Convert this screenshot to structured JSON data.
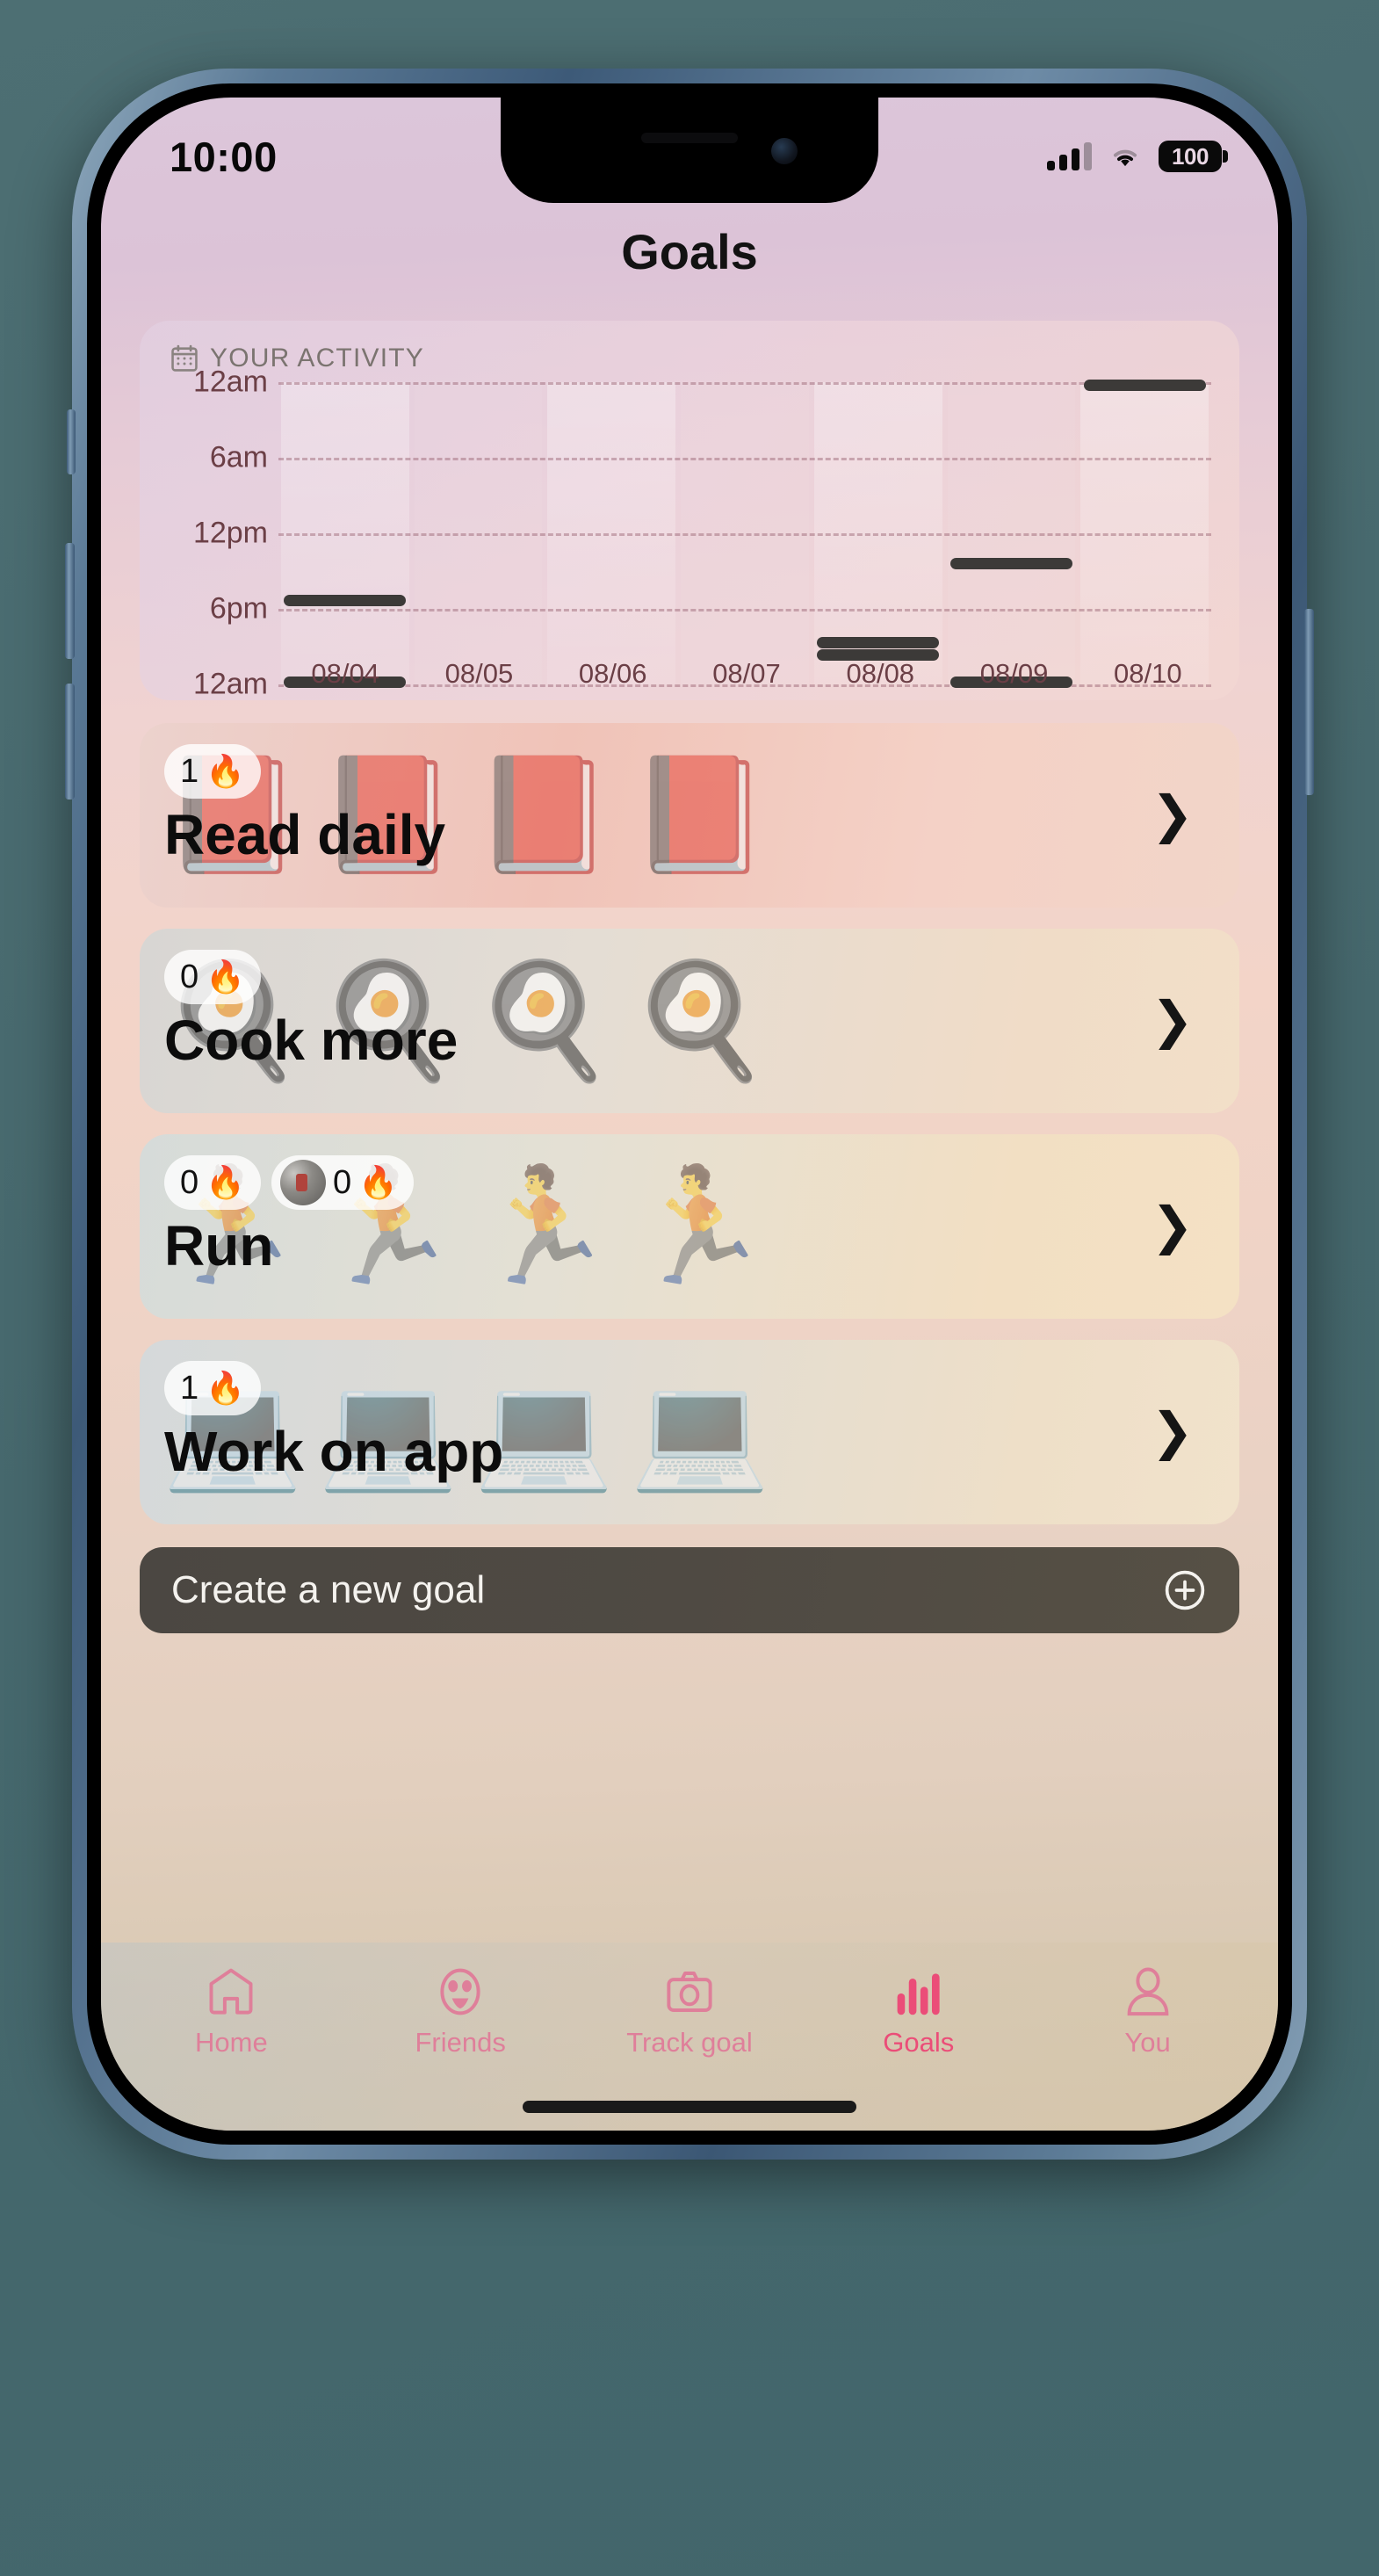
{
  "status_bar": {
    "time": "10:00",
    "signal_icon": "cellular-bars-icon",
    "wifi_icon": "wifi-icon",
    "battery_level": "100",
    "battery_icon": "battery-icon"
  },
  "header": {
    "title": "Goals"
  },
  "activity": {
    "icon": "calendar-icon",
    "label": "YOUR ACTIVITY"
  },
  "chart_data": {
    "type": "scatter",
    "title": "YOUR ACTIVITY",
    "xlabel": "",
    "ylabel": "",
    "categories": [
      "08/04",
      "08/05",
      "08/06",
      "08/07",
      "08/08",
      "08/09",
      "08/10"
    ],
    "ytick_labels": [
      "12am",
      "6am",
      "12pm",
      "6pm",
      "12am"
    ],
    "ytick_positions": [
      0,
      25,
      50,
      75,
      100
    ],
    "ylim": [
      0,
      100
    ],
    "grid": true,
    "legend": false,
    "note": "y axis runs 12am (top, midnight start) down through 6am, 12pm, 6pm to 12am (bottom, midnight end). Values are percent-from-top of plot area.",
    "series": [
      {
        "name": "activity-entries",
        "points": [
          {
            "x": "08/04",
            "y_pct": 72,
            "time_label": "6pm"
          },
          {
            "x": "08/04",
            "y_pct": 99,
            "time_label": "12am"
          },
          {
            "x": "08/08",
            "y_pct": 86,
            "time_label": "10pm"
          },
          {
            "x": "08/08",
            "y_pct": 90,
            "time_label": "11pm"
          },
          {
            "x": "08/09",
            "y_pct": 60,
            "time_label": "4pm"
          },
          {
            "x": "08/09",
            "y_pct": 99,
            "time_label": "12am"
          },
          {
            "x": "08/10",
            "y_pct": 1,
            "time_label": "12am"
          }
        ]
      }
    ]
  },
  "goals": [
    {
      "id": "read",
      "title": "Read daily",
      "emoji": "📕",
      "emoji_count": 4,
      "badges": [
        {
          "count": "1",
          "icon": "flame-icon",
          "glyph": "🔥",
          "avatar": false
        }
      ],
      "chevron": "chevron-right-icon"
    },
    {
      "id": "cook",
      "title": "Cook more",
      "emoji": "🍳",
      "emoji_count": 4,
      "badges": [
        {
          "count": "0",
          "icon": "flame-icon",
          "glyph": "🔥",
          "avatar": false
        }
      ],
      "chevron": "chevron-right-icon"
    },
    {
      "id": "run",
      "title": "Run",
      "emoji": "🏃",
      "emoji_count": 4,
      "badges": [
        {
          "count": "0",
          "icon": "flame-icon",
          "glyph": "🔥",
          "avatar": false
        },
        {
          "count": "0",
          "icon": "campfire-icon",
          "glyph": "🔥",
          "avatar": true
        }
      ],
      "chevron": "chevron-right-icon"
    },
    {
      "id": "work",
      "title": "Work on app",
      "emoji": "💻",
      "emoji_count": 4,
      "badges": [
        {
          "count": "1",
          "icon": "flame-icon",
          "glyph": "🔥",
          "avatar": false
        }
      ],
      "chevron": "chevron-right-icon"
    }
  ],
  "create_goal": {
    "label": "Create a new goal",
    "icon": "plus-circle-icon"
  },
  "tab_bar": {
    "active": "Goals",
    "items": [
      {
        "label": "Home",
        "icon": "home-icon",
        "active": false
      },
      {
        "label": "Friends",
        "icon": "friends-icon",
        "active": false
      },
      {
        "label": "Track goal",
        "icon": "camera-icon",
        "active": false
      },
      {
        "label": "Goals",
        "icon": "bar-chart-icon",
        "active": true
      },
      {
        "label": "You",
        "icon": "person-icon",
        "active": false
      }
    ]
  },
  "colors": {
    "accent_active": "#eb4d78",
    "accent_inactive": "#df7f9a",
    "title_text": "#121212",
    "chart_mark": "#3c3a38",
    "axis_text": "#6b3f46"
  }
}
